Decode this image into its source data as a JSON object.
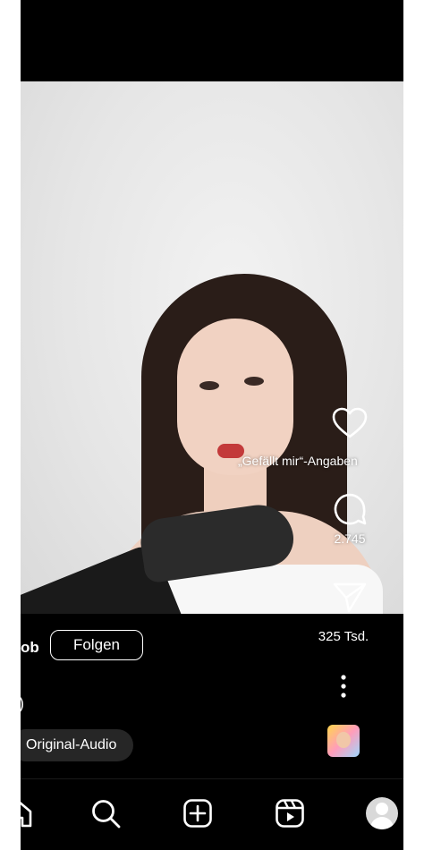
{
  "post": {
    "username": "ob",
    "follow_label": "Folgen",
    "caption": ")",
    "audio_label": "Original-Audio"
  },
  "actions": {
    "like_label": "„Gefällt mir“-Angaben",
    "comment_count": "2.745",
    "share_count": "325 Tsd."
  },
  "icons": {
    "like": "heart-icon",
    "comment": "comment-bubble-icon",
    "share": "paper-plane-icon",
    "more": "more-vertical-icon",
    "home": "home-icon",
    "search": "search-icon",
    "create": "plus-square-icon",
    "reels": "reels-icon",
    "profile": "profile-avatar-icon"
  }
}
